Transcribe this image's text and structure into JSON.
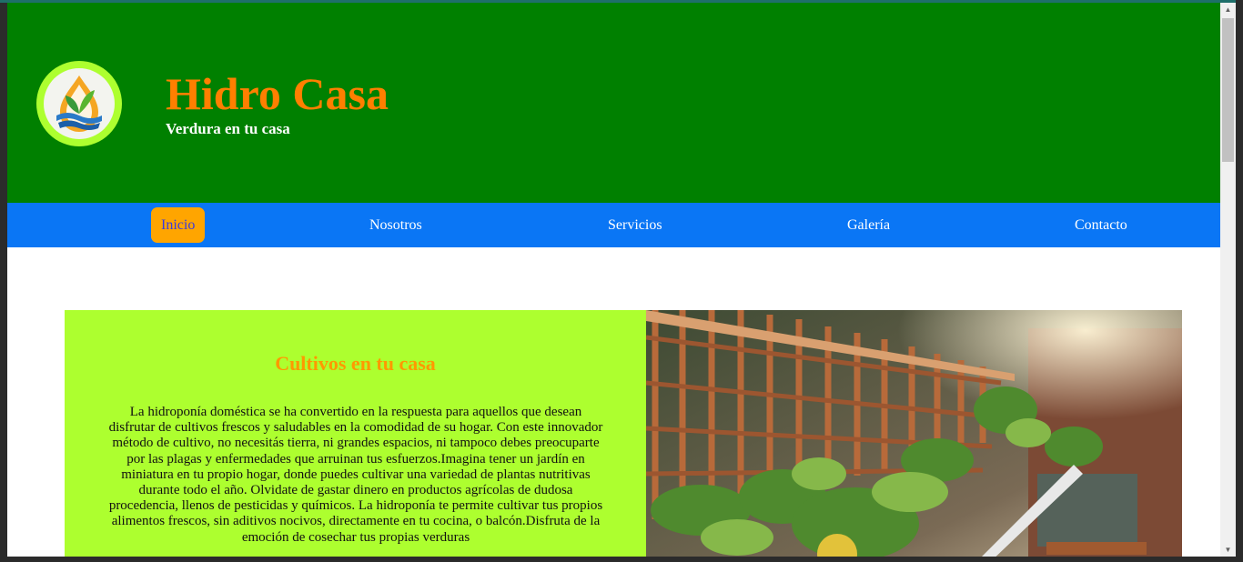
{
  "header": {
    "logo": "hydroponics-drop-leaf-logo",
    "title": "Hidro Casa",
    "subtitle": "Verdura en tu casa"
  },
  "nav": {
    "items": [
      {
        "label": "Inicio",
        "active": true
      },
      {
        "label": "Nosotros",
        "active": false
      },
      {
        "label": "Servicios",
        "active": false
      },
      {
        "label": "Galería",
        "active": false
      },
      {
        "label": "Contacto",
        "active": false
      }
    ]
  },
  "section": {
    "title": "Cultivos en tu casa",
    "body": "La hidroponía doméstica se ha convertido en la respuesta para aquellos que desean disfrutar de cultivos frescos y saludables en la comodidad de su hogar. Con este innovador método de cultivo, no necesitás tierra, ni grandes espacios, ni tampoco debes preocuparte por las plagas y enfermedades que arruinan tus esfuerzos.Imagina tener un jardín en miniatura en tu propio hogar, donde puedes cultivar una variedad de plantas nutritivas durante todo el año. Olvidate de gastar dinero en productos agrícolas de dudosa procedencia, llenos de pesticidas y químicos. La hidroponía te permite cultivar tus propios alimentos frescos, sin aditivos nocivos, directamente en tu cocina, o balcón.Disfruta de la emoción de cosechar tus propias verduras",
    "image": "hydroponic-garden-photo"
  },
  "colors": {
    "header_bg": "#008000",
    "title": "#ff7f00",
    "nav_bg": "#0a76f5",
    "nav_active_bg": "#ffa500",
    "panel_bg": "#adff2f",
    "section_title": "#ff9900"
  },
  "scrollbar": {
    "up_icon": "scroll-up-arrow-icon",
    "down_icon": "scroll-down-arrow-icon"
  }
}
